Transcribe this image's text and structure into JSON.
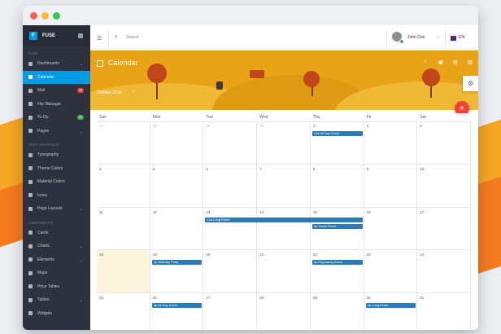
{
  "app": {
    "name": "FUSE",
    "logo": "F"
  },
  "sidebar": {
    "section_apps": "FUSE",
    "items_apps": [
      {
        "label": "Dashboards",
        "chevron": true
      },
      {
        "label": "Calendar",
        "active": true
      },
      {
        "label": "Mail",
        "badge": "25",
        "badge_color": "#f44336"
      },
      {
        "label": "File Manager"
      },
      {
        "label": "To-Do",
        "badge": "5",
        "badge_color": "#4caf50"
      },
      {
        "label": "Pages",
        "chevron": true
      }
    ],
    "section_ui": "USER INTERFACE",
    "items_ui": [
      {
        "label": "Typography"
      },
      {
        "label": "Theme Colors"
      },
      {
        "label": "Material Colors"
      },
      {
        "label": "Icons"
      },
      {
        "label": "Page Layouts",
        "chevron": true
      }
    ],
    "section_components": "COMPONENTS",
    "items_components": [
      {
        "label": "Cards"
      },
      {
        "label": "Charts",
        "chevron": true
      },
      {
        "label": "Elements",
        "chevron": true
      },
      {
        "label": "Maps"
      },
      {
        "label": "Price Tables"
      },
      {
        "label": "Tables",
        "chevron": true
      },
      {
        "label": "Widgets"
      }
    ]
  },
  "topbar": {
    "search_placeholder": "Search",
    "user_name": "John Doe",
    "language": "EN"
  },
  "calendar": {
    "title": "Calendar",
    "month_label": "October 2015",
    "weekdays": [
      "Sun",
      "Mon",
      "Tue",
      "Wed",
      "Thu",
      "Fri",
      "Sat"
    ],
    "weeks": [
      [
        "27",
        "28",
        "29",
        "30",
        "1",
        "2",
        "3"
      ],
      [
        "4",
        "5",
        "6",
        "7",
        "8",
        "9",
        "10"
      ],
      [
        "11",
        "12",
        "13",
        "14",
        "15",
        "16",
        "17"
      ],
      [
        "18",
        "19",
        "20",
        "21",
        "22",
        "23",
        "24"
      ],
      [
        "25",
        "26",
        "27",
        "28",
        "29",
        "30",
        "31"
      ]
    ],
    "today": {
      "week": 3,
      "day": 0
    },
    "events": [
      {
        "label": "12a All Day Event",
        "week": 0,
        "start": 4,
        "span": 1
      },
      {
        "label": "12a Long Event",
        "week": 2,
        "start": 2,
        "span": 3
      },
      {
        "label": "4p Some Event",
        "week": 2,
        "start": 4,
        "span": 1,
        "row": 1
      },
      {
        "label": "7p Birthday Party",
        "week": 3,
        "start": 1,
        "span": 1
      },
      {
        "label": "4p Repeating Event",
        "week": 3,
        "start": 4,
        "span": 1
      },
      {
        "label": "4p All Day Event",
        "week": 4,
        "start": 1,
        "span": 1
      },
      {
        "label": "4p Long Event",
        "week": 4,
        "start": 5,
        "span": 1
      }
    ]
  },
  "colors": {
    "accent": "#039be5",
    "event": "#2b7bb9",
    "fab": "#f44336",
    "banner": "#e8a317"
  }
}
